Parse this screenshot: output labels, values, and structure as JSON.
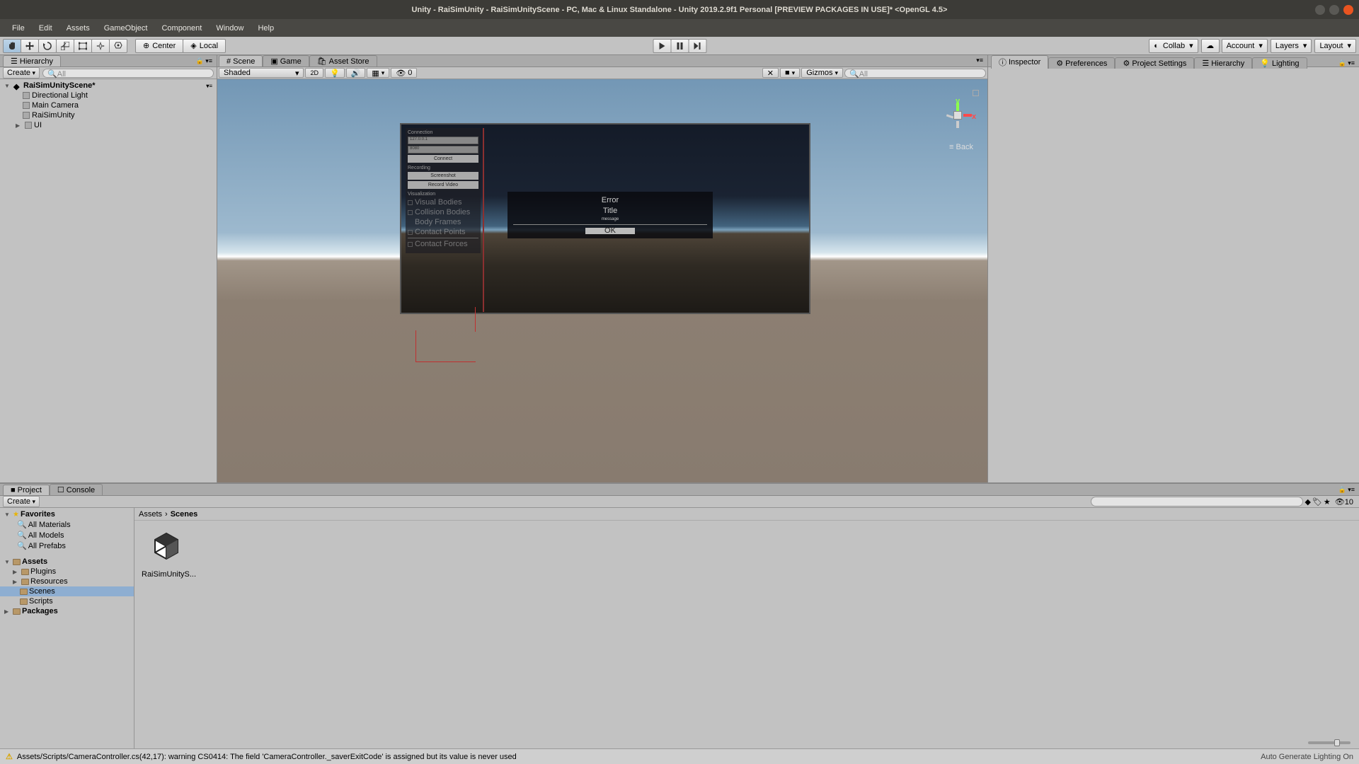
{
  "window": {
    "title": "Unity - RaiSimUnity - RaiSimUnityScene - PC, Mac & Linux Standalone - Unity 2019.2.9f1 Personal [PREVIEW PACKAGES IN USE]* <OpenGL 4.5>"
  },
  "menubar": [
    "File",
    "Edit",
    "Assets",
    "GameObject",
    "Component",
    "Window",
    "Help"
  ],
  "toolbar": {
    "pivot": "Center",
    "handle": "Local",
    "collab": "Collab",
    "account": "Account",
    "layers": "Layers",
    "layout": "Layout"
  },
  "hierarchy": {
    "tab": "Hierarchy",
    "create": "Create",
    "search_placeholder": "All",
    "root": "RaiSimUnityScene*",
    "items": [
      "Directional Light",
      "Main Camera",
      "RaiSimUnity",
      "UI"
    ]
  },
  "scene": {
    "tabs": [
      "Scene",
      "Game",
      "Asset Store"
    ],
    "shading": "Shaded",
    "mode2d": "2D",
    "gizmos": "Gizmos",
    "search_placeholder": "All",
    "fx_count": "0",
    "gizmo": {
      "back": "Back",
      "x": "x",
      "y": "y"
    }
  },
  "game_preview": {
    "sections": {
      "connection": {
        "title": "Connection",
        "ip": "127.0.0.1",
        "port": "8080",
        "connect": "Connect"
      },
      "recording": {
        "title": "Recording",
        "screenshot": "Screenshot",
        "record": "Record Video"
      },
      "visualization": {
        "title": "Visualization",
        "opts": [
          "Visual Bodies",
          "Collision Bodies",
          "Body Frames",
          "Contact Points",
          "Contact Forces"
        ]
      }
    },
    "dialog": {
      "error": "Error",
      "title": "Title",
      "message": "message",
      "ok": "OK"
    }
  },
  "inspector": {
    "tabs": [
      "Inspector",
      "Preferences",
      "Project Settings",
      "Hierarchy",
      "Lighting"
    ]
  },
  "project": {
    "tabs": [
      "Project",
      "Console"
    ],
    "create": "Create",
    "favorites": {
      "label": "Favorites",
      "items": [
        "All Materials",
        "All Models",
        "All Prefabs"
      ]
    },
    "assets": {
      "label": "Assets",
      "items": [
        "Plugins",
        "Resources",
        "Scenes",
        "Scripts"
      ]
    },
    "packages": "Packages",
    "breadcrumb": [
      "Assets",
      "Scenes"
    ],
    "grid": {
      "scene_name": "RaiSimUnityS..."
    },
    "search_count": "10"
  },
  "statusbar": {
    "warning": "Assets/Scripts/CameraController.cs(42,17): warning CS0414: The field 'CameraController._saverExitCode' is assigned but its value is never used",
    "right": "Auto Generate Lighting On"
  }
}
